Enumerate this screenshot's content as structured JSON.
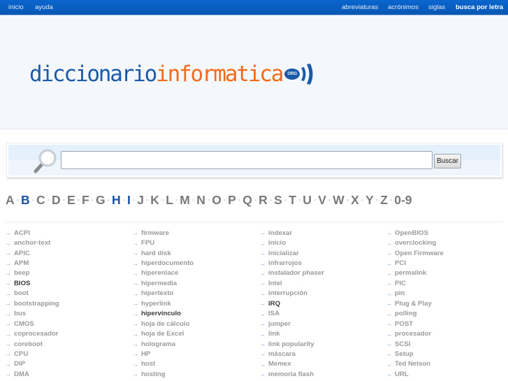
{
  "topnav": {
    "left": [
      "inicio",
      "ayuda"
    ],
    "right": [
      "abreviaturas",
      "acrónimos",
      "siglas",
      "busca por letra"
    ]
  },
  "logo": {
    "part1": "diccionario",
    "part2": "informatica",
    "badge": "ORG"
  },
  "search": {
    "value": "",
    "placeholder": "",
    "button": "Buscar"
  },
  "alphabet": {
    "letters": [
      "A",
      "B",
      "C",
      "D",
      "E",
      "F",
      "G",
      "H",
      "I",
      "J",
      "K",
      "L",
      "M",
      "N",
      "O",
      "P",
      "Q",
      "R",
      "S",
      "T",
      "U",
      "V",
      "W",
      "X",
      "Y",
      "Z",
      "0-9"
    ],
    "highlighted": [
      "B",
      "H",
      "I"
    ],
    "separator": "-"
  },
  "columns": [
    {
      "items": [
        {
          "label": "ACPI"
        },
        {
          "label": "anchor-text"
        },
        {
          "label": "APIC"
        },
        {
          "label": "APM"
        },
        {
          "label": "beep"
        },
        {
          "label": "BIOS",
          "dark": true
        },
        {
          "label": "boot"
        },
        {
          "label": "bootstrapping"
        },
        {
          "label": "bus"
        },
        {
          "label": "CMOS"
        },
        {
          "label": "coprocesador"
        },
        {
          "label": "coreboot"
        },
        {
          "label": "CPU"
        },
        {
          "label": "DIP"
        },
        {
          "label": "DMA"
        }
      ]
    },
    {
      "items": [
        {
          "label": "firmware"
        },
        {
          "label": "FPU"
        },
        {
          "label": "hard disk"
        },
        {
          "label": "hiperdocumento"
        },
        {
          "label": "hiperenlace"
        },
        {
          "label": "hipermedia"
        },
        {
          "label": "hipertexto"
        },
        {
          "label": "hyperlink"
        },
        {
          "label": "hipervínculo",
          "dark": true
        },
        {
          "label": "hoja de cálculo"
        },
        {
          "label": "hoja de Excel"
        },
        {
          "label": "holograma"
        },
        {
          "label": "HP"
        },
        {
          "label": "host"
        },
        {
          "label": "hosting"
        }
      ]
    },
    {
      "items": [
        {
          "label": "indexar"
        },
        {
          "label": "inicio"
        },
        {
          "label": "inicializar"
        },
        {
          "label": "infrarrojos"
        },
        {
          "label": "instalador phaser"
        },
        {
          "label": "Intel"
        },
        {
          "label": "interrupción"
        },
        {
          "label": "IRQ",
          "dark": true
        },
        {
          "label": "ISA"
        },
        {
          "label": "jumper"
        },
        {
          "label": "link"
        },
        {
          "label": "link popularity"
        },
        {
          "label": "máscara"
        },
        {
          "label": "Memex"
        },
        {
          "label": "memoria flash"
        }
      ]
    },
    {
      "items": [
        {
          "label": "OpenBIOS"
        },
        {
          "label": "overclocking"
        },
        {
          "label": "Open Firmware"
        },
        {
          "label": "PCI"
        },
        {
          "label": "permalink"
        },
        {
          "label": "PIC"
        },
        {
          "label": "pin"
        },
        {
          "label": "Plug & Play"
        },
        {
          "label": "polling"
        },
        {
          "label": "POST"
        },
        {
          "label": "procesador"
        },
        {
          "label": "SCSI"
        },
        {
          "label": "Setup"
        },
        {
          "label": "Ted Nelson"
        },
        {
          "label": "URL"
        }
      ]
    }
  ],
  "icons": {
    "list_bullet": "arrow-right-icon",
    "search": "magnifier-icon"
  },
  "colors": {
    "topbar": "#0757b3",
    "logo_blue": "#1a5aa8",
    "logo_orange": "#f26b1a",
    "active_letter": "#1652a8"
  }
}
